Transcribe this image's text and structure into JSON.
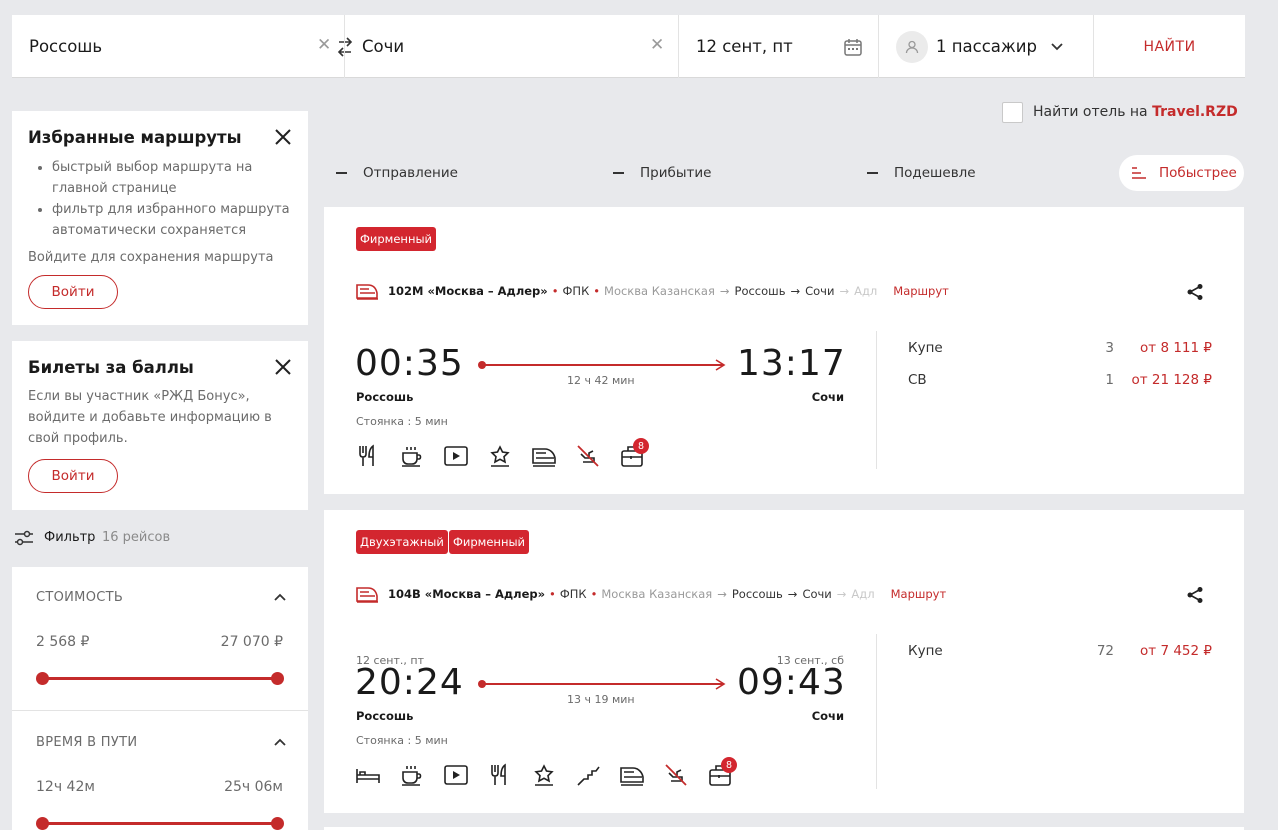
{
  "search": {
    "from": "Россошь",
    "to": "Сочи",
    "date": "12 сент, пт",
    "passengers": "1 пассажир",
    "find_label": "НАЙТИ"
  },
  "hotel": {
    "label": "Найти отель на ",
    "brand": "Travel.RZD"
  },
  "favorites": {
    "title": "Избранные маршруты",
    "bullets": [
      "быстрый выбор маршрута на главной странице",
      "фильтр для избранного маршрута автоматически сохраняется"
    ],
    "note": "Войдите для сохранения маршрута",
    "login_label": "Войти"
  },
  "bonus": {
    "title": "Билеты за баллы",
    "text": "Если вы участник «РЖД Бонус», войдите и добавьте информацию в свой профиль.",
    "login_label": "Войти"
  },
  "filter": {
    "label": "Фильтр",
    "count": "16 рейсов",
    "cost": {
      "label": "СТОИМОСТЬ",
      "min": "2 568 ₽",
      "max": "27 070 ₽"
    },
    "duration": {
      "label": "ВРЕМЯ В ПУТИ",
      "min": "12ч 42м",
      "max": "25ч 06м"
    }
  },
  "sort": {
    "departure": "Отправление",
    "arrival": "Прибытие",
    "cheaper": "Подешевле",
    "faster": "Побыстрее"
  },
  "colors": {
    "accent": "#c42b2b",
    "badge": "#d3262f",
    "background": "#e8e9ec"
  },
  "trips": [
    {
      "badges": [
        "Фирменный"
      ],
      "train": "102М «Москва – Адлер»",
      "carrier": "ФПК",
      "route_start": "Москва Казанская",
      "route_from": "Россошь",
      "route_to": "Сочи",
      "route_end": "Адл",
      "route_link": "Маршрут",
      "dep_date": "",
      "arr_date": "",
      "dep_time": "00:35",
      "arr_time": "13:17",
      "duration": "12 ч 42 мин",
      "dep_station": "Россошь",
      "arr_station": "Сочи",
      "stop": "Стоянка : 5 мин",
      "amenities": [
        "restaurant-icon",
        "coffee-icon",
        "video-icon",
        "premium-service-icon",
        "train-icon",
        "no-pets-icon",
        "luggage-icon"
      ],
      "luggage_count": "8",
      "classes": [
        {
          "name": "Купе",
          "seats": "3",
          "price": "от 8 111 ₽"
        },
        {
          "name": "СВ",
          "seats": "1",
          "price": "от 21 128 ₽"
        }
      ]
    },
    {
      "badges": [
        "Двухэтажный",
        "Фирменный"
      ],
      "train": "104В «Москва – Адлер»",
      "carrier": "ФПК",
      "route_start": "Москва Казанская",
      "route_from": "Россошь",
      "route_to": "Сочи",
      "route_end": "Адл",
      "route_link": "Маршрут",
      "dep_date": "12 сент., пт",
      "arr_date": "13 сент., сб",
      "dep_time": "20:24",
      "arr_time": "09:43",
      "duration": "13 ч 19 мин",
      "dep_station": "Россошь",
      "arr_station": "Сочи",
      "stop": "Стоянка : 5 мин",
      "amenities": [
        "bed-icon",
        "coffee-icon",
        "video-icon",
        "restaurant-icon",
        "premium-service-icon",
        "stairs-icon",
        "train-icon",
        "no-pets-icon",
        "luggage-icon"
      ],
      "luggage_count": "8",
      "classes": [
        {
          "name": "Купе",
          "seats": "72",
          "price": "от 7 452 ₽"
        }
      ]
    }
  ]
}
